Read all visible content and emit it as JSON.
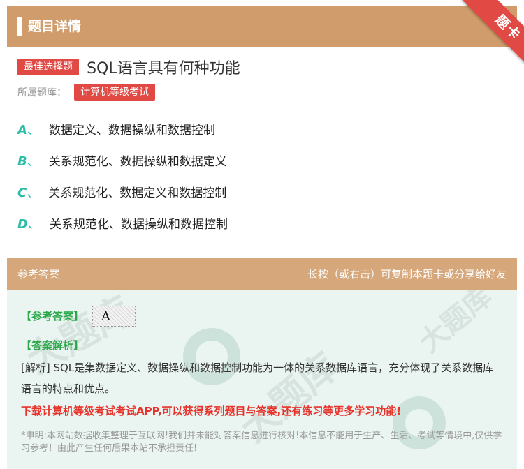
{
  "header": {
    "title": "题目详情",
    "ribbon": "题卡"
  },
  "question": {
    "type_tag": "最佳选择题",
    "title": "SQL语言具有何种功能",
    "library_label": "所属题库：",
    "library_tag": "计算机等级考试"
  },
  "options": [
    {
      "letter": "A",
      "sep": "、",
      "text": "数据定义、数据操纵和数据控制"
    },
    {
      "letter": "B",
      "sep": "、",
      "text": "关系规范化、数据操纵和数据定义"
    },
    {
      "letter": "C",
      "sep": "、",
      "text": "关系规范化、数据定义和数据控制"
    },
    {
      "letter": "D",
      "sep": "、",
      "text": "关系规范化、数据操纵和数据控制"
    }
  ],
  "answer": {
    "header_left": "参考答案",
    "header_right": "长按（或右击）可复制本题卡或分享给好友",
    "ref_label": "【参考答案】",
    "ref_value": "A",
    "analysis_label": "【答案解析】",
    "analysis_text": "[解析] SQL是集数据定义、数据操纵和数据控制功能为一体的关系数据库语言，充分体现了关系数据库语言的特点和优点。",
    "promo": "下载计算机等级考试考试APP,可以获得系列题目与答案,还有练习等更多学习功能!",
    "disclaimer": "*申明:本网站数据收集整理于互联网!我们并未能对答案信息进行核对!本信息不能用于生产、生活、考试等情境中,仅供学习参考！由此产生任何后果本站不承担责任!"
  },
  "colors": {
    "header_bg": "#d09c6b",
    "accent_red": "#e14a44",
    "option_letter": "#2cbca8",
    "answer_bg": "#eaf5f1",
    "green_label": "#2aa84a",
    "promo_red": "#e8332c"
  }
}
